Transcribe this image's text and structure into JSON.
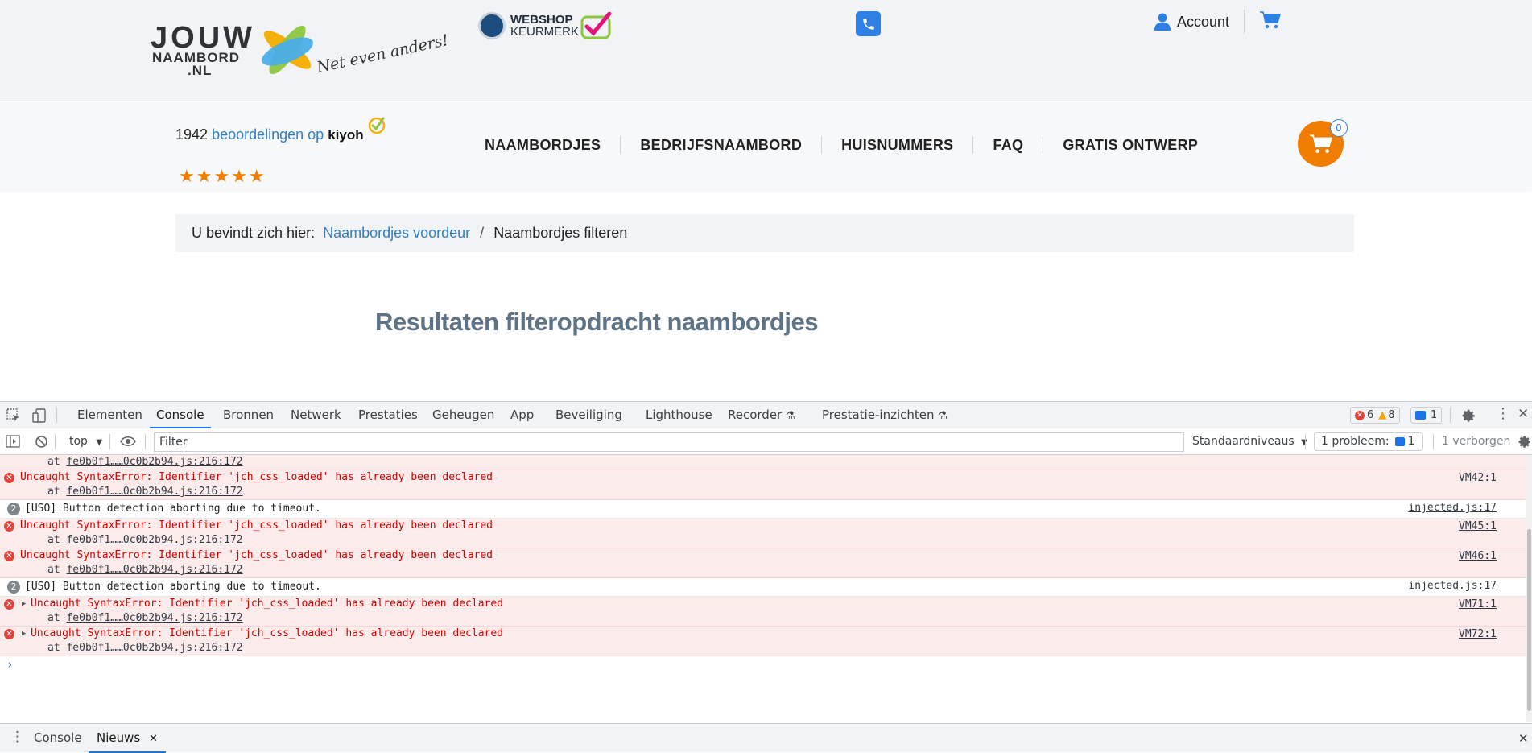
{
  "header": {
    "logo": {
      "line1": "JOUW",
      "line2": "NAAMBORD",
      "line3": ".NL",
      "slogan": "Net even anders!"
    },
    "keurmerk": {
      "line1": "WEBSHOP",
      "line2": "KEURMERK"
    },
    "account_label": "Account"
  },
  "navbar": {
    "reviews_count": "1942",
    "reviews_link": "beoordelingen op",
    "reviews_brand": "kiyoh",
    "stars": "★★★★★",
    "items": [
      {
        "label": "NAAMBORDJES"
      },
      {
        "label": "BEDRIJFSNAAMBORD"
      },
      {
        "label": "HUISNUMMERS"
      },
      {
        "label": "FAQ"
      },
      {
        "label": "GRATIS ONTWERP"
      }
    ],
    "cart_count": "0"
  },
  "breadcrumb": {
    "prefix": "U bevindt zich hier:",
    "link": "Naambordjes voordeur",
    "separator": "/",
    "current": "Naambordjes filteren"
  },
  "page_title": "Resultaten filteropdracht naambordjes",
  "devtools": {
    "tabs": [
      {
        "label": "Elementen"
      },
      {
        "label": "Console"
      },
      {
        "label": "Bronnen"
      },
      {
        "label": "Netwerk"
      },
      {
        "label": "Prestaties"
      },
      {
        "label": "Geheugen"
      },
      {
        "label": "App"
      },
      {
        "label": "Beveiliging"
      },
      {
        "label": "Lighthouse"
      },
      {
        "label": "Recorder"
      },
      {
        "label": "Prestatie-inzichten"
      }
    ],
    "active_tab": "Console",
    "error_count": "6",
    "warning_count": "8",
    "message_count": "1",
    "toolbar": {
      "context": "top",
      "filter_placeholder": "Filter",
      "levels": "Standaardniveaus",
      "problems_label": "1 probleem:",
      "problems_count": "1",
      "hidden": "1 verborgen"
    },
    "console_rows": [
      {
        "type": "error-tail",
        "trace_prefix": "at ",
        "trace": "fe0b0f1……0c0b2b94.js:216:172"
      },
      {
        "type": "error",
        "message": "Uncaught SyntaxError: Identifier 'jch_css_loaded' has already been declared",
        "trace_prefix": "at ",
        "trace": "fe0b0f1……0c0b2b94.js:216:172",
        "source": "VM42:1"
      },
      {
        "type": "info",
        "badge": "2",
        "message": "[USO] Button detection aborting due to timeout.",
        "source": "injected.js:17"
      },
      {
        "type": "error",
        "message": "Uncaught SyntaxError: Identifier 'jch_css_loaded' has already been declared",
        "trace_prefix": "at ",
        "trace": "fe0b0f1……0c0b2b94.js:216:172",
        "source": "VM45:1"
      },
      {
        "type": "error",
        "message": "Uncaught SyntaxError: Identifier 'jch_css_loaded' has already been declared",
        "trace_prefix": "at ",
        "trace": "fe0b0f1……0c0b2b94.js:216:172",
        "source": "VM46:1"
      },
      {
        "type": "info",
        "badge": "2",
        "message": "[USO] Button detection aborting due to timeout.",
        "source": "injected.js:17"
      },
      {
        "type": "error-expandable",
        "message": "Uncaught SyntaxError: Identifier 'jch_css_loaded' has already been declared",
        "trace_prefix": "at ",
        "trace": "fe0b0f1……0c0b2b94.js:216:172",
        "source": "VM71:1"
      },
      {
        "type": "error-expandable",
        "message": "Uncaught SyntaxError: Identifier 'jch_css_loaded' has already been declared",
        "trace_prefix": "at ",
        "trace": "fe0b0f1……0c0b2b94.js:216:172",
        "source": "VM72:1"
      }
    ],
    "prompt": "›",
    "drawer_tabs": [
      {
        "label": "Console"
      },
      {
        "label": "Nieuws"
      }
    ],
    "drawer_active": "Nieuws"
  },
  "colors": {
    "accent_orange": "#f07d00",
    "link_blue": "#2f80c8",
    "devtools_active": "#1a73e8",
    "error_red": "#d40000",
    "error_bg": "#fcebeb"
  }
}
